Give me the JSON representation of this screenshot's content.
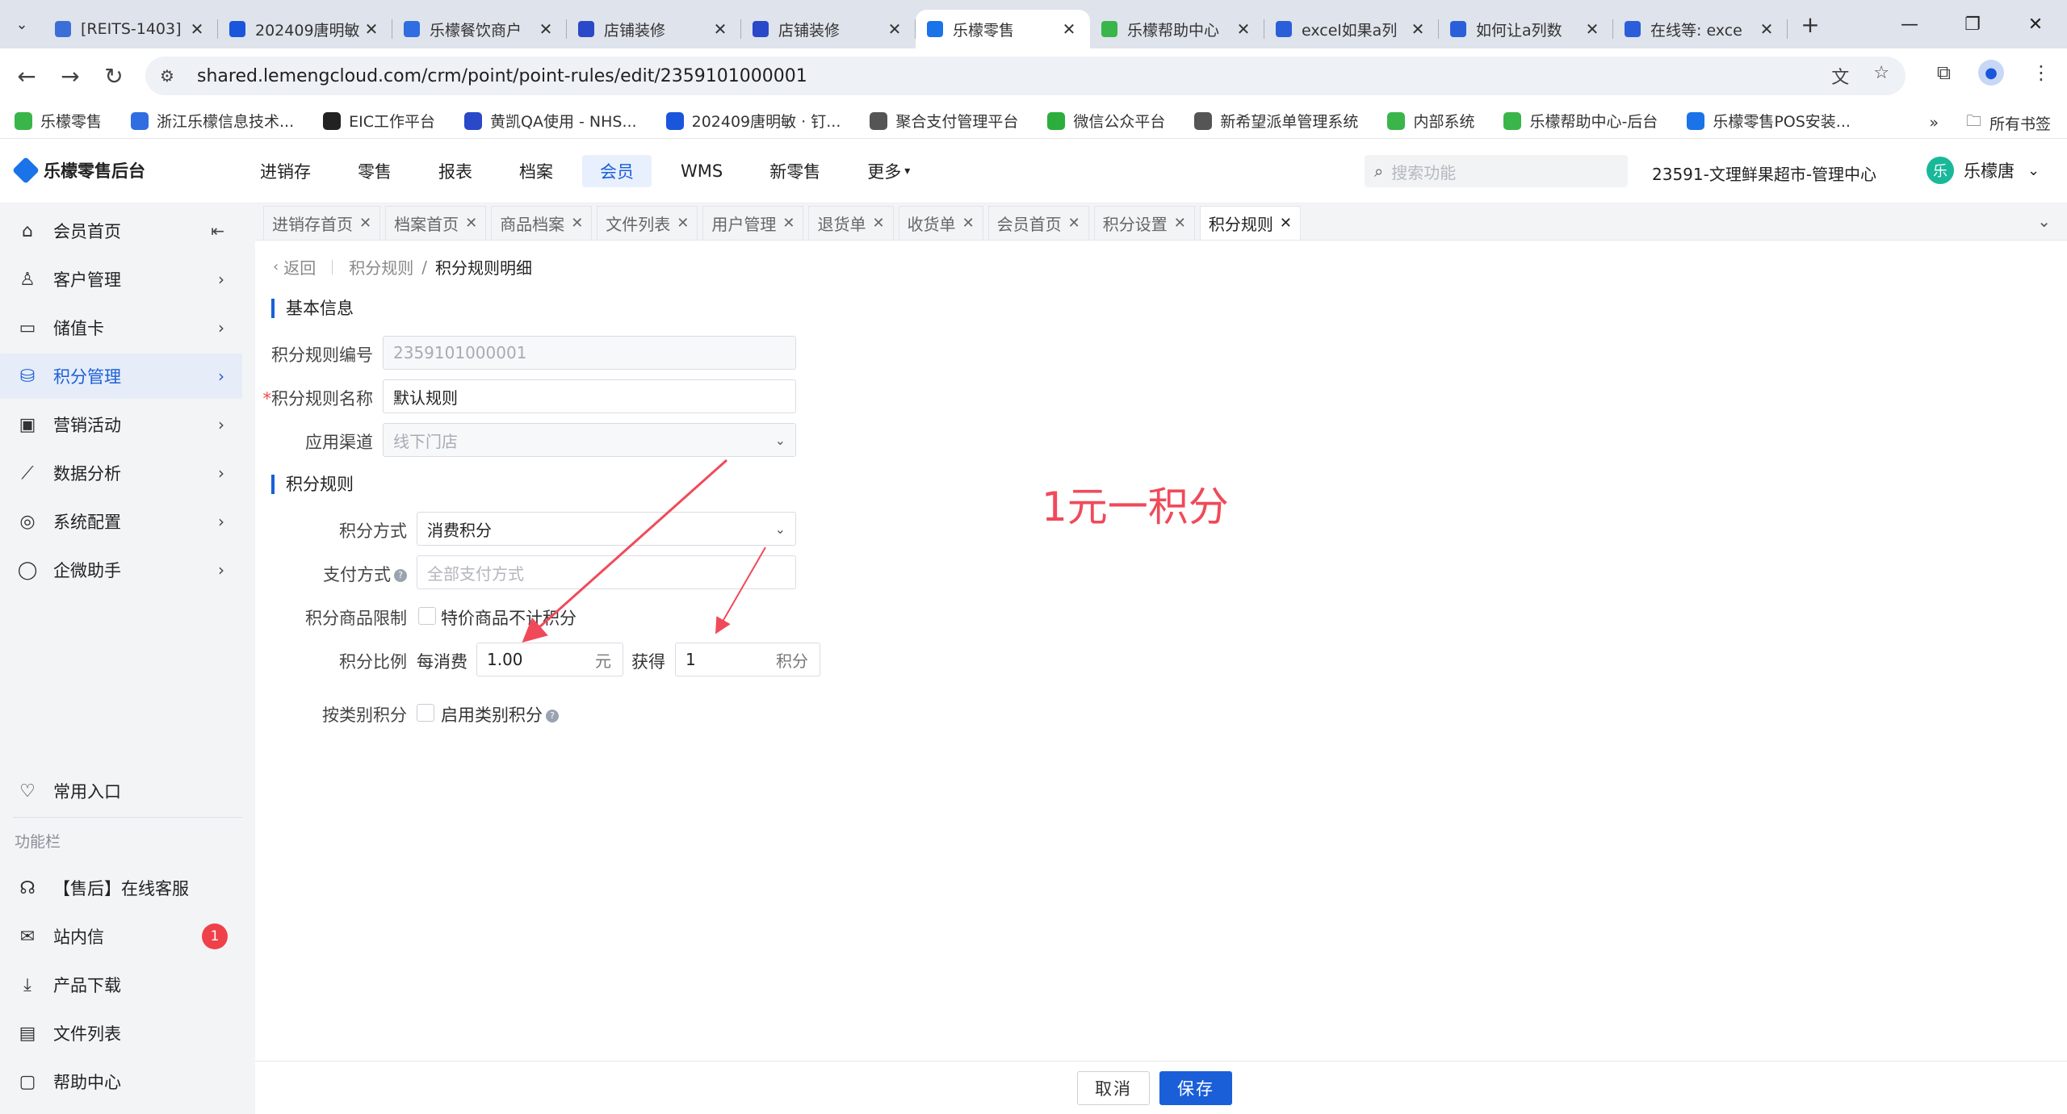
{
  "browser": {
    "tabs": [
      {
        "title": "[REITS-1403]",
        "color": "#3b6fd8",
        "active": false
      },
      {
        "title": "202409唐明敏",
        "color": "#1a56db",
        "active": false
      },
      {
        "title": "乐檬餐饮商户",
        "color": "#2f6de1",
        "active": false
      },
      {
        "title": "店铺装修",
        "color": "#2a49c8",
        "active": false
      },
      {
        "title": "店铺装修",
        "color": "#2a49c8",
        "active": false
      },
      {
        "title": "乐檬零售",
        "color": "#1a73e8",
        "active": true
      },
      {
        "title": "乐檬帮助中心",
        "color": "#3ab54a",
        "active": false
      },
      {
        "title": "excel如果a列",
        "color": "#2b5fd9",
        "active": false
      },
      {
        "title": "如何让a列数",
        "color": "#2b5fd9",
        "active": false
      },
      {
        "title": "在线等: exce",
        "color": "#2b5fd9",
        "active": false
      }
    ],
    "url": "shared.lemengcloud.com/crm/point/point-rules/edit/2359101000001",
    "bookmarks": [
      {
        "label": "乐檬零售",
        "color": "#3ab54a"
      },
      {
        "label": "浙江乐檬信息技术...",
        "color": "#2f6de1"
      },
      {
        "label": "EIC工作平台",
        "color": "#222222"
      },
      {
        "label": "黄凯QA使用 - NHS...",
        "color": "#2a49c8"
      },
      {
        "label": "202409唐明敏 · 钉...",
        "color": "#1a56db"
      },
      {
        "label": "聚合支付管理平台",
        "color": "#555555"
      },
      {
        "label": "微信公众平台",
        "color": "#2bae3c"
      },
      {
        "label": "新希望派单管理系统",
        "color": "#555555"
      },
      {
        "label": "内部系统",
        "color": "#3ab54a"
      },
      {
        "label": "乐檬帮助中心-后台",
        "color": "#3ab54a"
      },
      {
        "label": "乐檬零售POS安装...",
        "color": "#1a73e8"
      }
    ],
    "bookmarks_all": "所有书签"
  },
  "app": {
    "logo": "乐檬零售后台",
    "nav": [
      "进销存",
      "零售",
      "报表",
      "档案",
      "会员",
      "WMS",
      "新零售",
      "更多"
    ],
    "nav_active": 4,
    "search_placeholder": "搜索功能",
    "store": "23591-文理鲜果超市-管理中心",
    "user_initial": "乐",
    "user_name": "乐檬唐"
  },
  "sidebar": {
    "items": [
      {
        "label": "会员首页",
        "icon": "home-icon"
      },
      {
        "label": "客户管理",
        "icon": "user-icon"
      },
      {
        "label": "储值卡",
        "icon": "card-icon"
      },
      {
        "label": "积分管理",
        "icon": "database-icon"
      },
      {
        "label": "营销活动",
        "icon": "monitor-icon"
      },
      {
        "label": "数据分析",
        "icon": "chart-line-icon"
      },
      {
        "label": "系统配置",
        "icon": "settings-icon"
      },
      {
        "label": "企微助手",
        "icon": "chat-icon"
      }
    ],
    "active": 3,
    "common": "常用入口",
    "section": "功能栏",
    "functions": [
      {
        "label": "【售后】在线客服",
        "icon": "headset-icon"
      },
      {
        "label": "站内信",
        "icon": "mail-icon",
        "badge": "1"
      },
      {
        "label": "产品下载",
        "icon": "download-icon"
      },
      {
        "label": "文件列表",
        "icon": "file-list-icon"
      },
      {
        "label": "帮助中心",
        "icon": "help-chat-icon"
      }
    ]
  },
  "page_tabs": [
    "进销存首页",
    "档案首页",
    "商品档案",
    "文件列表",
    "用户管理",
    "退货单",
    "收货单",
    "会员首页",
    "积分设置",
    "积分规则"
  ],
  "page_tabs_active": 9,
  "breadcrumb": {
    "back": "返回",
    "parent": "积分规则",
    "separator": "/",
    "current": "积分规则明细"
  },
  "basic": {
    "title": "基本信息",
    "rule_no_label": "积分规则编号",
    "rule_no_value": "2359101000001",
    "rule_name_label": "积分规则名称",
    "rule_name_value": "默认规则",
    "channel_label": "应用渠道",
    "channel_placeholder": "线下门店"
  },
  "rules": {
    "title": "积分规则",
    "method_label": "积分方式",
    "method_value": "消费积分",
    "pay_label": "支付方式",
    "pay_placeholder": "全部支付方式",
    "limit_label": "积分商品限制",
    "limit_option": "特价商品不计积分",
    "ratio_label": "积分比例",
    "ratio_prefix": "每消费",
    "ratio_amount": "1.00",
    "ratio_unit": "元",
    "ratio_get": "获得",
    "ratio_points": "1",
    "ratio_points_unit": "积分",
    "category_label": "按类别积分",
    "category_option": "启用类别积分"
  },
  "annotation": "1元一积分",
  "footer": {
    "cancel": "取消",
    "save": "保存"
  }
}
